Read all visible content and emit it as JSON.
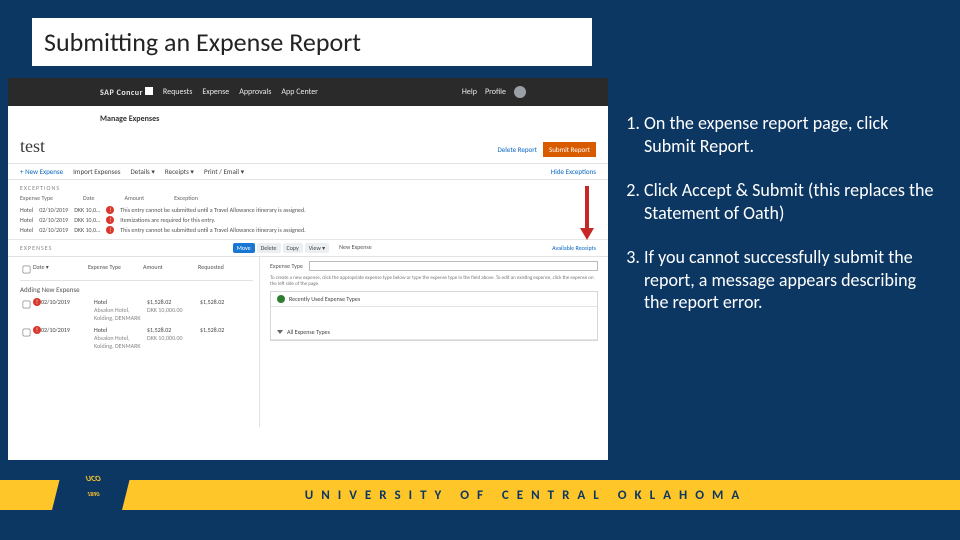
{
  "slide": {
    "title": "Submitting an Expense Report"
  },
  "instructions": {
    "items": [
      "On the expense report page, click Submit Report.",
      "Click Accept & Submit (this replaces the Statement of Oath)",
      "If you cannot successfully submit the report, a message appears describing the report error."
    ]
  },
  "concur": {
    "logo": "SAP Concur",
    "nav": [
      "Requests",
      "Expense",
      "Approvals",
      "App Center"
    ],
    "help": "Help",
    "profile": "Profile",
    "manage": "Manage Expenses",
    "report_name": "test",
    "delete_link": "Delete Report",
    "submit_btn": "Submit Report",
    "toolbar": {
      "new_expense": "+ New Expense",
      "import": "Import Expenses",
      "details": "Details ▾",
      "receipts": "Receipts ▾",
      "print": "Print / Email ▾",
      "hide": "Hide Exceptions"
    },
    "exceptions": {
      "title": "EXCEPTIONS",
      "headers": [
        "Expense Type",
        "Date",
        "Amount",
        "Exception"
      ],
      "rows": [
        {
          "type": "Hotel",
          "date": "02/10/2019",
          "amt": "DKK 10,0…",
          "msg": "This entry cannot be submitted until a Travel Allowance itinerary is assigned."
        },
        {
          "type": "Hotel",
          "date": "02/10/2019",
          "amt": "DKK 10,0…",
          "msg": "Itemizations are required for this entry."
        },
        {
          "type": "Hotel",
          "date": "02/10/2019",
          "amt": "DKK 10,0…",
          "msg": "This entry cannot be submitted until a Travel Allowance itinerary is assigned."
        }
      ]
    },
    "expenses": {
      "title": "EXPENSES",
      "chips": [
        "Move",
        "Delete",
        "Copy",
        "View"
      ],
      "new_panel": "New Expense",
      "avail_link": "Available Receipts",
      "list_headers": [
        "Date ▾",
        "Expense Type",
        "Amount",
        "Requested"
      ],
      "adding": "Adding New Expense",
      "rows": [
        {
          "date": "02/10/2019",
          "type": "Hotel",
          "sub": "Absalon Hotel, Kolding, DENMARK",
          "amt": "$1,528.02",
          "req": "$1,528.02",
          "amt2": "DKK 10,000.00"
        },
        {
          "date": "02/10/2019",
          "type": "Hotel",
          "sub": "Absalon Hotel, Kolding, DENMARK",
          "amt": "$1,528.02",
          "req": "$1,528.02",
          "amt2": "DKK 10,000.00"
        }
      ],
      "field_label": "Expense Type",
      "note": "To create a new expense, click the appropriate expense type below or type the expense type in the field above. To edit an existing expense, click the expense on the left side of the page.",
      "recent": "Recently Used Expense Types",
      "all": "All Expense Types"
    }
  },
  "footer": {
    "logo_top": "UCO",
    "logo_bottom": "1890",
    "text": "UNIVERSITY OF CENTRAL OKLAHOMA"
  }
}
